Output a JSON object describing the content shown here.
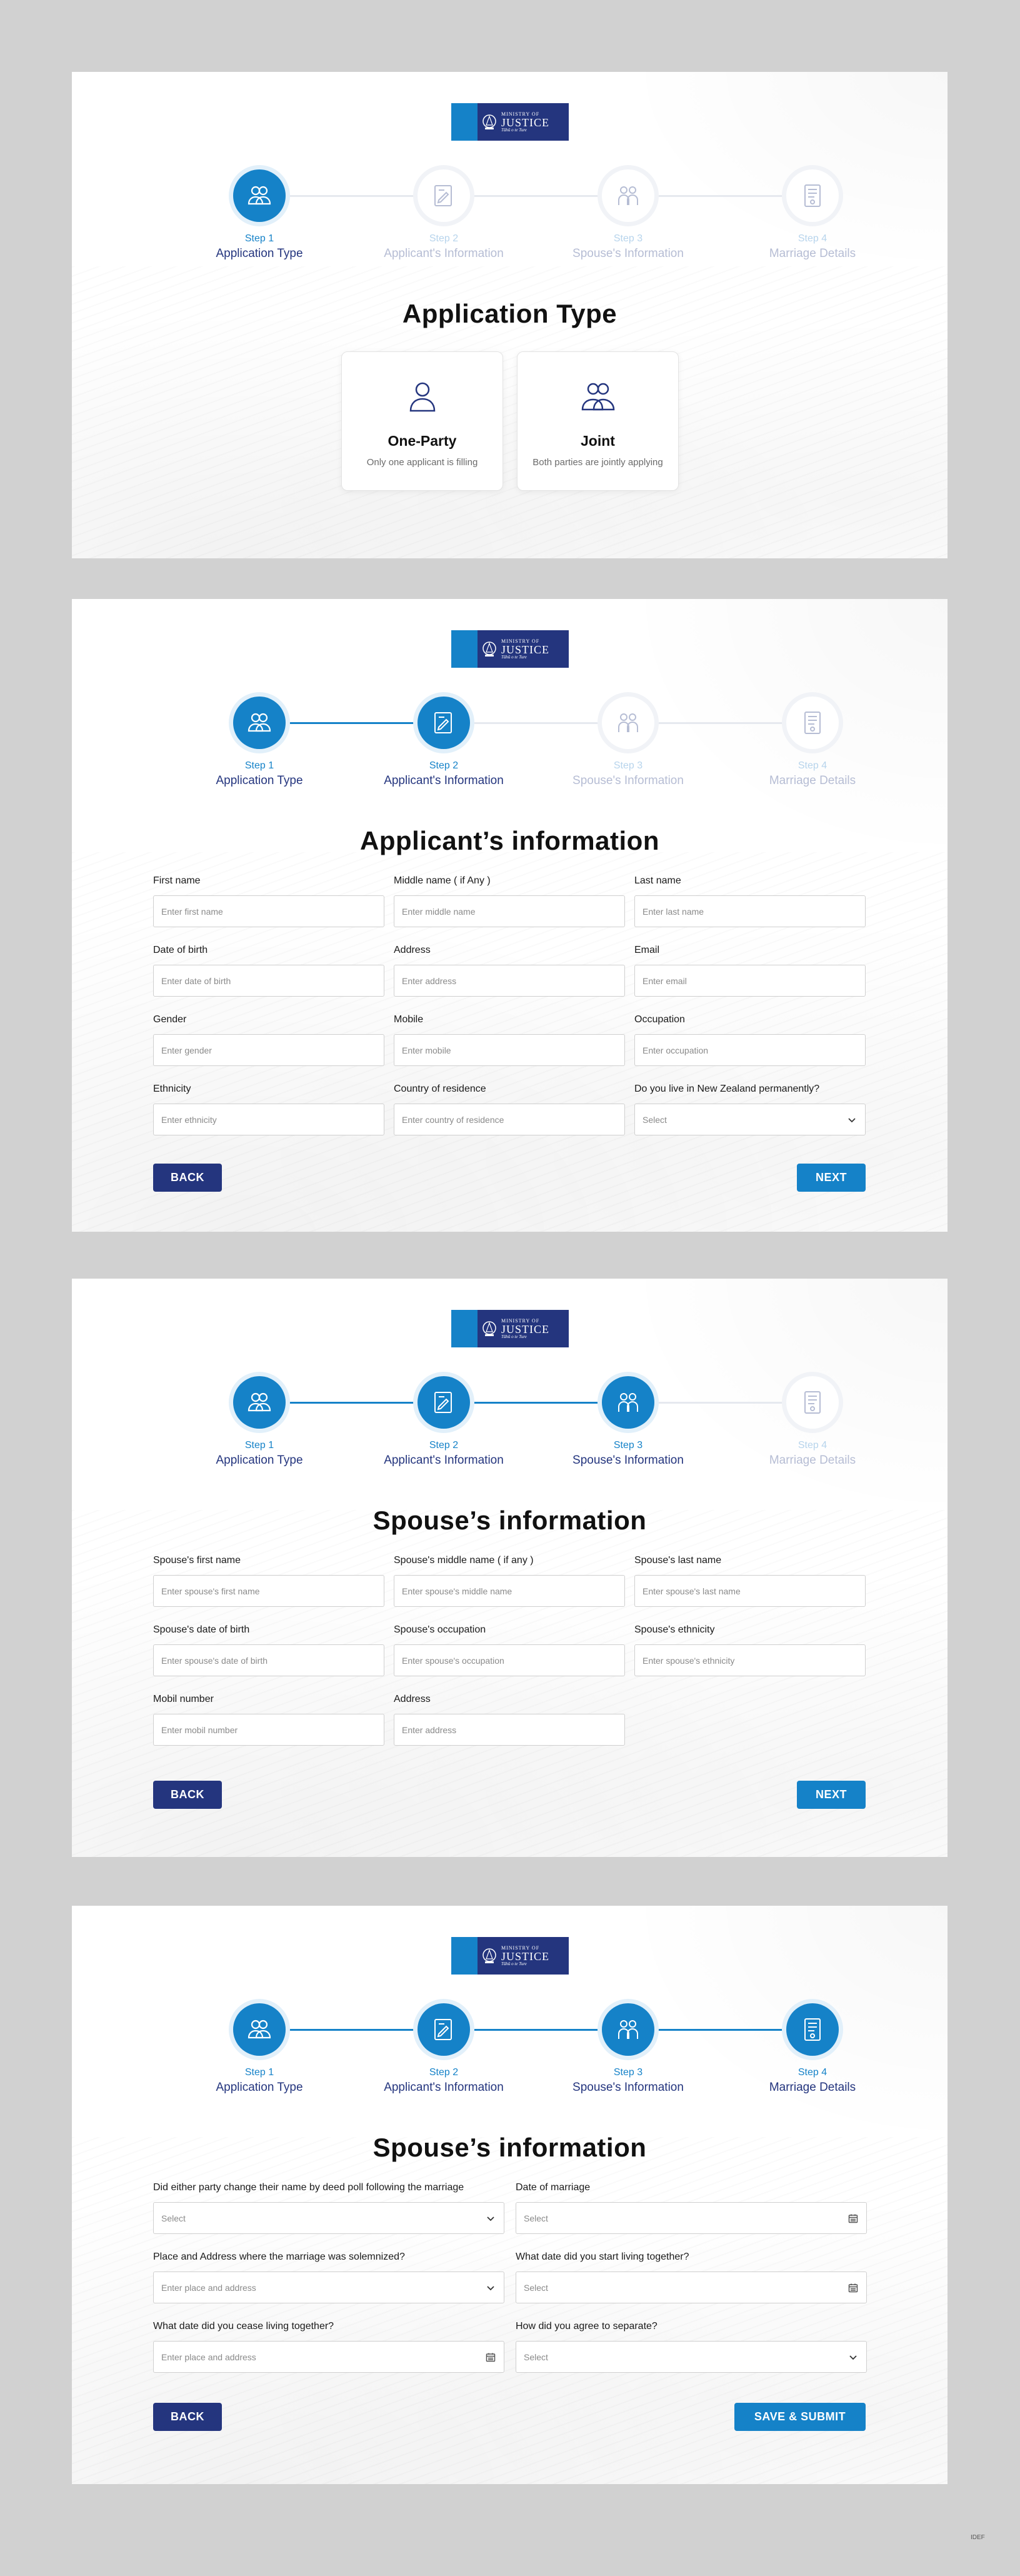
{
  "logo": {
    "small": "MINISTRY OF",
    "big": "JUSTICE",
    "tagline": "Tāhū o te Ture"
  },
  "steps": [
    {
      "num": "Step 1",
      "label": "Application Type",
      "icon": "people-icon"
    },
    {
      "num": "Step 2",
      "label": "Applicant's Information",
      "icon": "document-pen-icon"
    },
    {
      "num": "Step 3",
      "label": "Spouse's Information",
      "icon": "couple-icon"
    },
    {
      "num": "Step 4",
      "label": "Marriage Details",
      "icon": "certificate-icon"
    }
  ],
  "screen1": {
    "title": "Application Type",
    "cards": [
      {
        "title": "One-Party",
        "sub": "Only one applicant is filling"
      },
      {
        "title": "Joint",
        "sub": "Both parties are jointly applying"
      }
    ]
  },
  "screen2": {
    "title": "Applicant’s information",
    "fields": [
      {
        "label": "First name",
        "placeholder": "Enter first name"
      },
      {
        "label": "Middle name ( if Any )",
        "placeholder": "Enter middle name"
      },
      {
        "label": "Last name",
        "placeholder": "Enter last name"
      },
      {
        "label": "Date of birth",
        "placeholder": "Enter date of birth"
      },
      {
        "label": "Address",
        "placeholder": "Enter address"
      },
      {
        "label": "Email",
        "placeholder": "Enter email"
      },
      {
        "label": "Gender",
        "placeholder": "Enter gender"
      },
      {
        "label": "Mobile",
        "placeholder": "Enter mobile"
      },
      {
        "label": "Occupation",
        "placeholder": "Enter occupation"
      },
      {
        "label": "Ethnicity",
        "placeholder": "Enter ethnicity"
      },
      {
        "label": "Country of residence",
        "placeholder": "Enter country of residence"
      },
      {
        "label": "Do you live in New Zealand permanently?",
        "placeholder": "Select"
      }
    ]
  },
  "screen3": {
    "title": "Spouse’s information",
    "fields": [
      {
        "label": "Spouse's first name",
        "placeholder": "Enter spouse's first name"
      },
      {
        "label": "Spouse's middle name ( if any )",
        "placeholder": "Enter spouse's middle name"
      },
      {
        "label": "Spouse's last name",
        "placeholder": "Enter spouse's last name"
      },
      {
        "label": "Spouse's date of birth",
        "placeholder": "Enter spouse's date of birth"
      },
      {
        "label": "Spouse's occupation",
        "placeholder": "Enter spouse's occupation"
      },
      {
        "label": "Spouse's ethnicity",
        "placeholder": "Enter spouse's ethnicity"
      },
      {
        "label": "Mobil number",
        "placeholder": "Enter mobil number"
      },
      {
        "label": "Address",
        "placeholder": "Enter address"
      }
    ]
  },
  "screen4": {
    "title": "Spouse’s information",
    "fields": [
      {
        "label": "Did either party change their name by deed poll following the marriage",
        "placeholder": "Select"
      },
      {
        "label": "Date of marriage",
        "placeholder": "Select"
      },
      {
        "label": "Place and Address where the marriage was solemnized?",
        "placeholder": "Enter place and address"
      },
      {
        "label": "What date did you start living together?",
        "placeholder": "Select"
      },
      {
        "label": "What date did you cease living together?",
        "placeholder": "Enter place and address"
      },
      {
        "label": "How did you agree to separate?",
        "placeholder": "Select"
      }
    ]
  },
  "buttons": {
    "back": "BACK",
    "next": "NEXT",
    "submit": "SAVE & SUBMIT"
  },
  "corner_tag": "IDEF",
  "colors": {
    "brand_blue": "#1582c8",
    "navy": "#24357e"
  }
}
